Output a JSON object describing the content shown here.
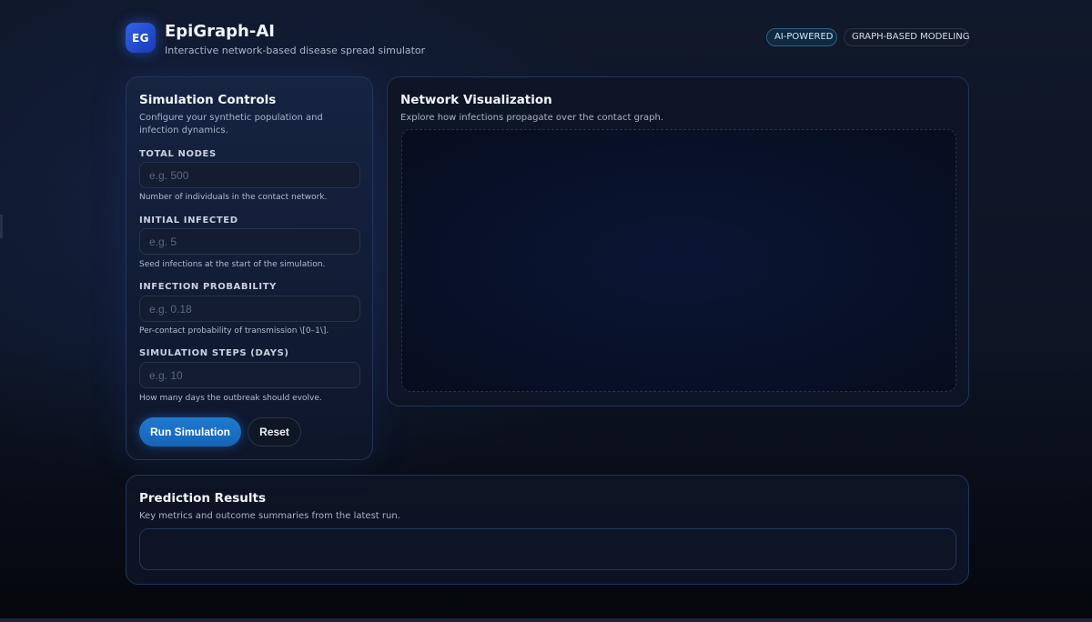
{
  "header": {
    "logo_text": "EG",
    "title": "EpiGraph-AI",
    "subtitle": "Interactive network-based disease spread simulator",
    "badges": [
      "AI-POWERED",
      "GRAPH-BASED MODELING"
    ]
  },
  "controls": {
    "title": "Simulation Controls",
    "description": "Configure your synthetic population and infection dynamics.",
    "fields": [
      {
        "label": "TOTAL NODES",
        "placeholder": "e.g. 500",
        "value": "",
        "help": "Number of individuals in the contact network."
      },
      {
        "label": "INITIAL INFECTED",
        "placeholder": "e.g. 5",
        "value": "",
        "help": "Seed infections at the start of the simulation."
      },
      {
        "label": "INFECTION PROBABILITY",
        "placeholder": "e.g. 0.18",
        "value": "",
        "help": "Per-contact probability of transmission \\[0–1\\]."
      },
      {
        "label": "SIMULATION STEPS (DAYS)",
        "placeholder": "e.g. 10",
        "value": "",
        "help": "How many days the outbreak should evolve."
      }
    ],
    "run_label": "Run Simulation",
    "reset_label": "Reset"
  },
  "network": {
    "title": "Network Visualization",
    "description": "Explore how infections propagate over the contact graph."
  },
  "results": {
    "title": "Prediction Results",
    "description": "Key metrics and outcome summaries from the latest run."
  },
  "colors": {
    "accent": "#1f7ad0",
    "background": "#0d1424",
    "card_border": "#223459"
  }
}
